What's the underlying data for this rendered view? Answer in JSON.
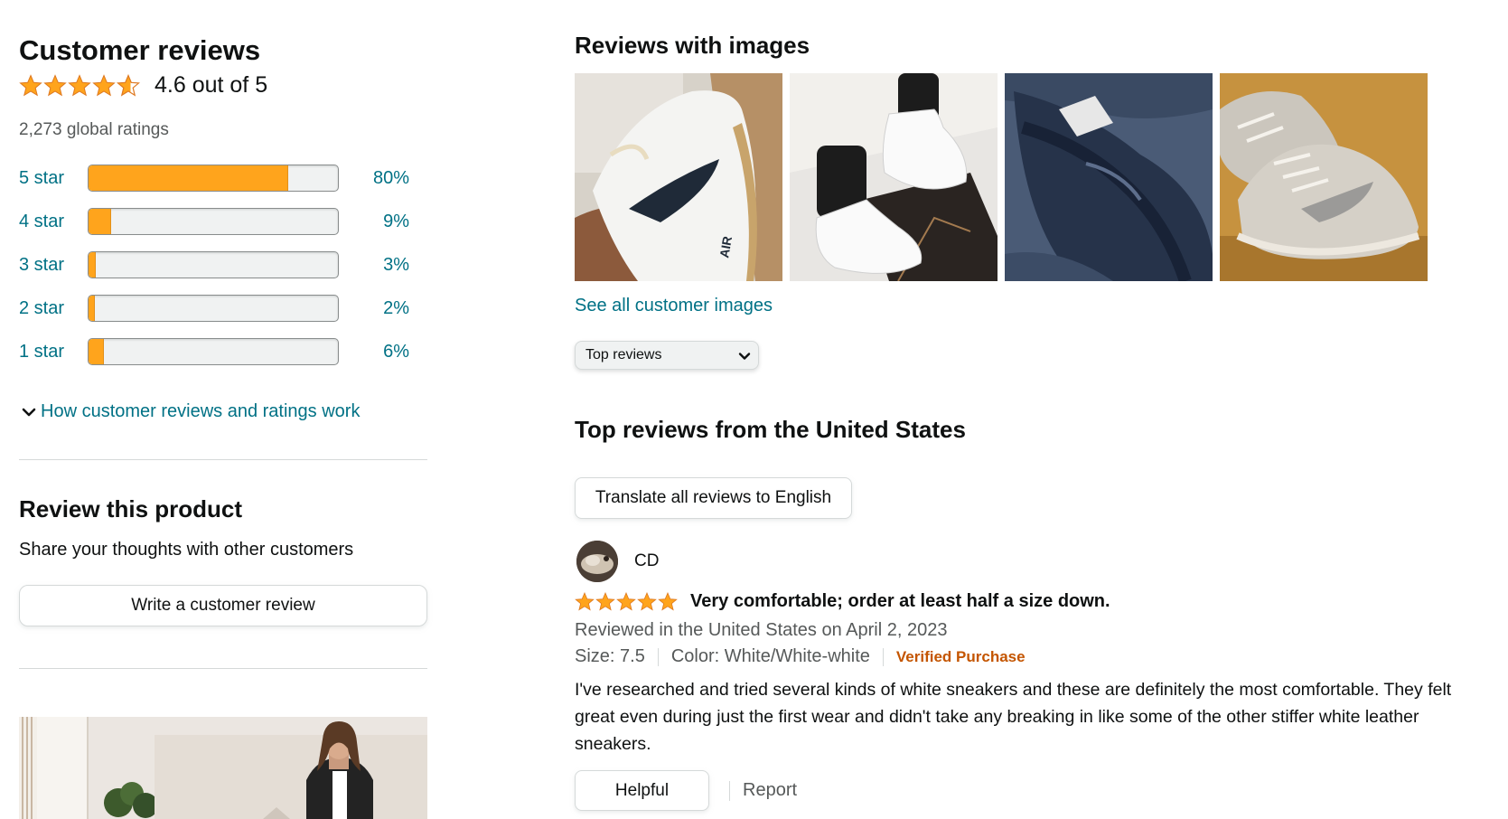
{
  "customer_reviews": {
    "title": "Customer reviews",
    "average_rating": 4.6,
    "average_text": "4.6 out of 5",
    "global_ratings": "2,273 global ratings",
    "histogram": [
      {
        "label": "5 star",
        "percent_text": "80%",
        "percent": 80
      },
      {
        "label": "4 star",
        "percent_text": "9%",
        "percent": 9
      },
      {
        "label": "3 star",
        "percent_text": "3%",
        "percent": 3
      },
      {
        "label": "2 star",
        "percent_text": "2%",
        "percent": 2
      },
      {
        "label": "1 star",
        "percent_text": "6%",
        "percent": 6
      }
    ],
    "how_link": "How customer reviews and ratings work"
  },
  "review_product": {
    "title": "Review this product",
    "subtitle": "Share your thoughts with other customers",
    "button_label": "Write a customer review"
  },
  "images_section": {
    "title": "Reviews with images",
    "thumbnails": [
      "white-black-swoosh-sneaker",
      "white-sneakers-worn",
      "black-sneaker",
      "grey-suede-sneakers"
    ],
    "see_all_link": "See all customer images"
  },
  "sort": {
    "selected": "Top reviews"
  },
  "top_reviews": {
    "title": "Top reviews from the United States",
    "translate_button": "Translate all reviews to English",
    "reviews": [
      {
        "reviewer": "CD",
        "rating": 5,
        "title": "Very comfortable; order at least half a size down.",
        "date": "Reviewed in the United States on April 2, 2023",
        "size": "Size: 7.5",
        "color": "Color: White/White-white",
        "verified": "Verified Purchase",
        "body": "I've researched and tried several kinds of white sneakers and these are definitely the most comfortable. They felt great even during just the first wear and didn't take any breaking in like some of the other stiffer white leather sneakers.",
        "helpful_label": "Helpful",
        "report_label": "Report"
      }
    ]
  },
  "colors": {
    "star": "#ffa41c",
    "link": "#007185",
    "verified": "#c45500",
    "muted": "#565959"
  }
}
